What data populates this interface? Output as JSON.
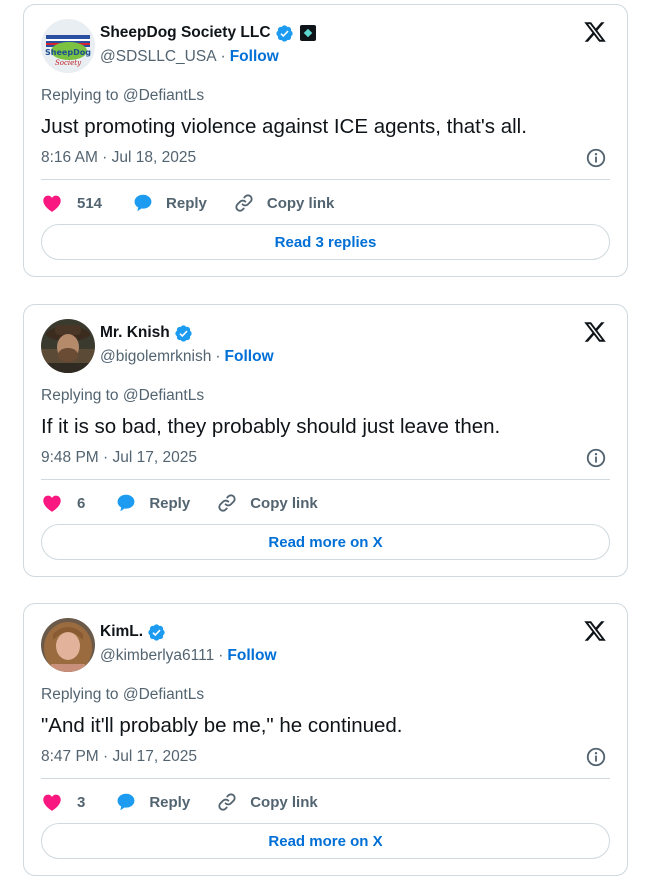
{
  "tweets": [
    {
      "name": "SheepDog Society LLC",
      "handle": "@SDSLLC_USA",
      "separator": "·",
      "follow": "Follow",
      "replying_prefix": "Replying to",
      "replying_to": "@DefiantLs",
      "text": "Just promoting violence against ICE agents, that's all.",
      "time": "8:16 AM · Jul 18, 2025",
      "likes": "514",
      "reply_label": "Reply",
      "copy_label": "Copy link",
      "read_label": "Read 3 replies",
      "avatar_text": [
        "SheepDog",
        "Society"
      ]
    },
    {
      "name": "Mr. Knish",
      "handle": "@bigolemrknish",
      "separator": "·",
      "follow": "Follow",
      "replying_prefix": "Replying to",
      "replying_to": "@DefiantLs",
      "text": "If it is so bad, they probably should just leave then.",
      "time": "9:48 PM · Jul 17, 2025",
      "likes": "6",
      "reply_label": "Reply",
      "copy_label": "Copy link",
      "read_label": "Read more on X"
    },
    {
      "name": "KimL.",
      "handle": "@kimberlya6111",
      "separator": "·",
      "follow": "Follow",
      "replying_prefix": "Replying to",
      "replying_to": "@DefiantLs",
      "text": "\"And it'll probably be me,\" he continued.",
      "time": "8:47 PM · Jul 17, 2025",
      "likes": "3",
      "reply_label": "Reply",
      "copy_label": "Copy link",
      "read_label": "Read more on X"
    }
  ],
  "colors": {
    "text": "#0f1419",
    "secondary": "#536471",
    "link": "#006fd6",
    "verified": "#1d9bf0",
    "like": "#f91880",
    "reply_icon": "#1d9bf0",
    "border": "#cfd9de"
  },
  "icons": {
    "verified": "verified-badge-icon",
    "x_logo": "x-logo-icon",
    "info": "info-icon",
    "like": "heart-icon",
    "reply": "speech-bubble-icon",
    "copy": "link-icon",
    "affiliate": "affiliate-badge-icon"
  }
}
